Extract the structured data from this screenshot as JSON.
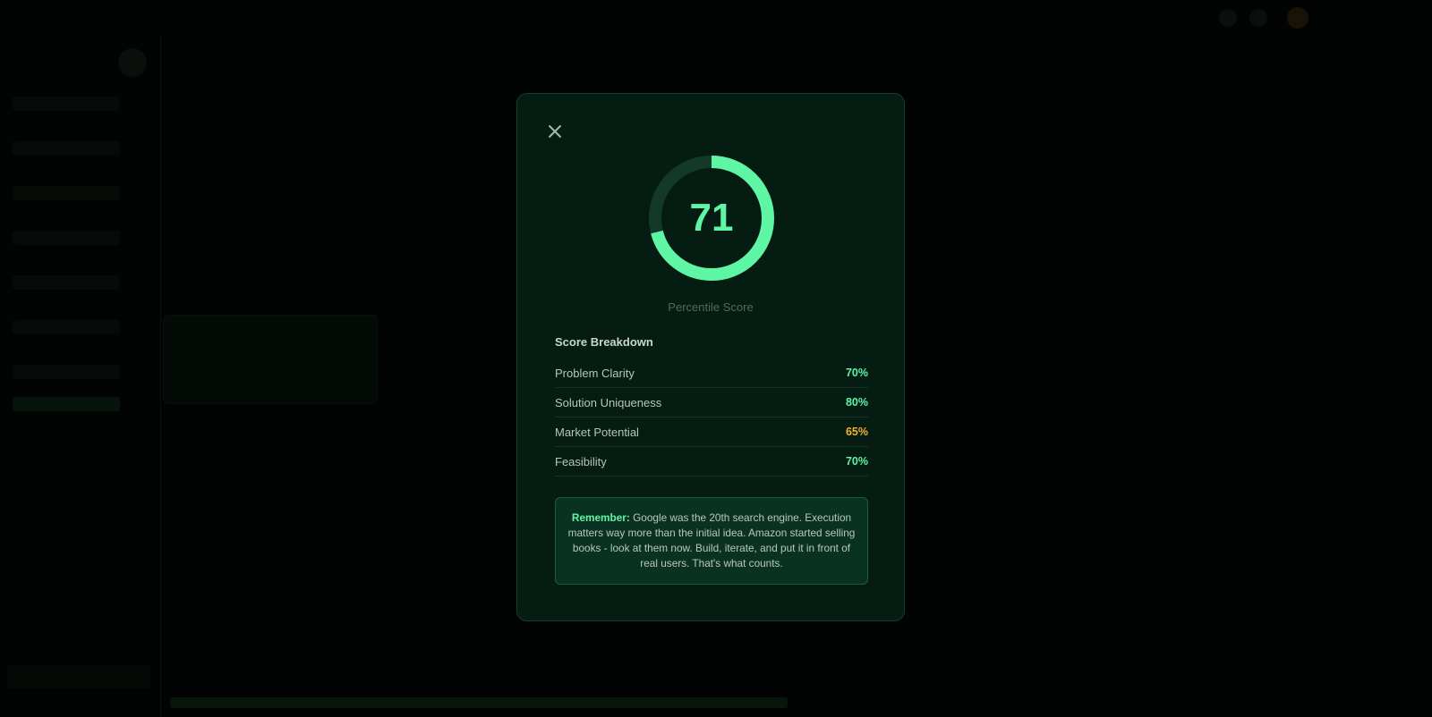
{
  "modal": {
    "close_icon": "close-icon",
    "score": {
      "value": "71",
      "percent": 71,
      "label": "Percentile Score",
      "track_color": "#133a28",
      "fill_color": "#5ef5a4"
    },
    "breakdown": {
      "title": "Score Breakdown",
      "rows": [
        {
          "label": "Problem Clarity",
          "value": "70%",
          "color": "#5ef5a4"
        },
        {
          "label": "Solution Uniqueness",
          "value": "80%",
          "color": "#5ef5a4"
        },
        {
          "label": "Market Potential",
          "value": "65%",
          "color": "#f2b32c"
        },
        {
          "label": "Feasibility",
          "value": "70%",
          "color": "#5ef5a4"
        }
      ]
    },
    "remember": {
      "label": "Remember:",
      "text": "Google was the 20th search engine. Execution matters way more than the initial idea. Amazon started selling books - look at them now. Build, iterate, and put it in front of real users. That's what counts."
    }
  }
}
